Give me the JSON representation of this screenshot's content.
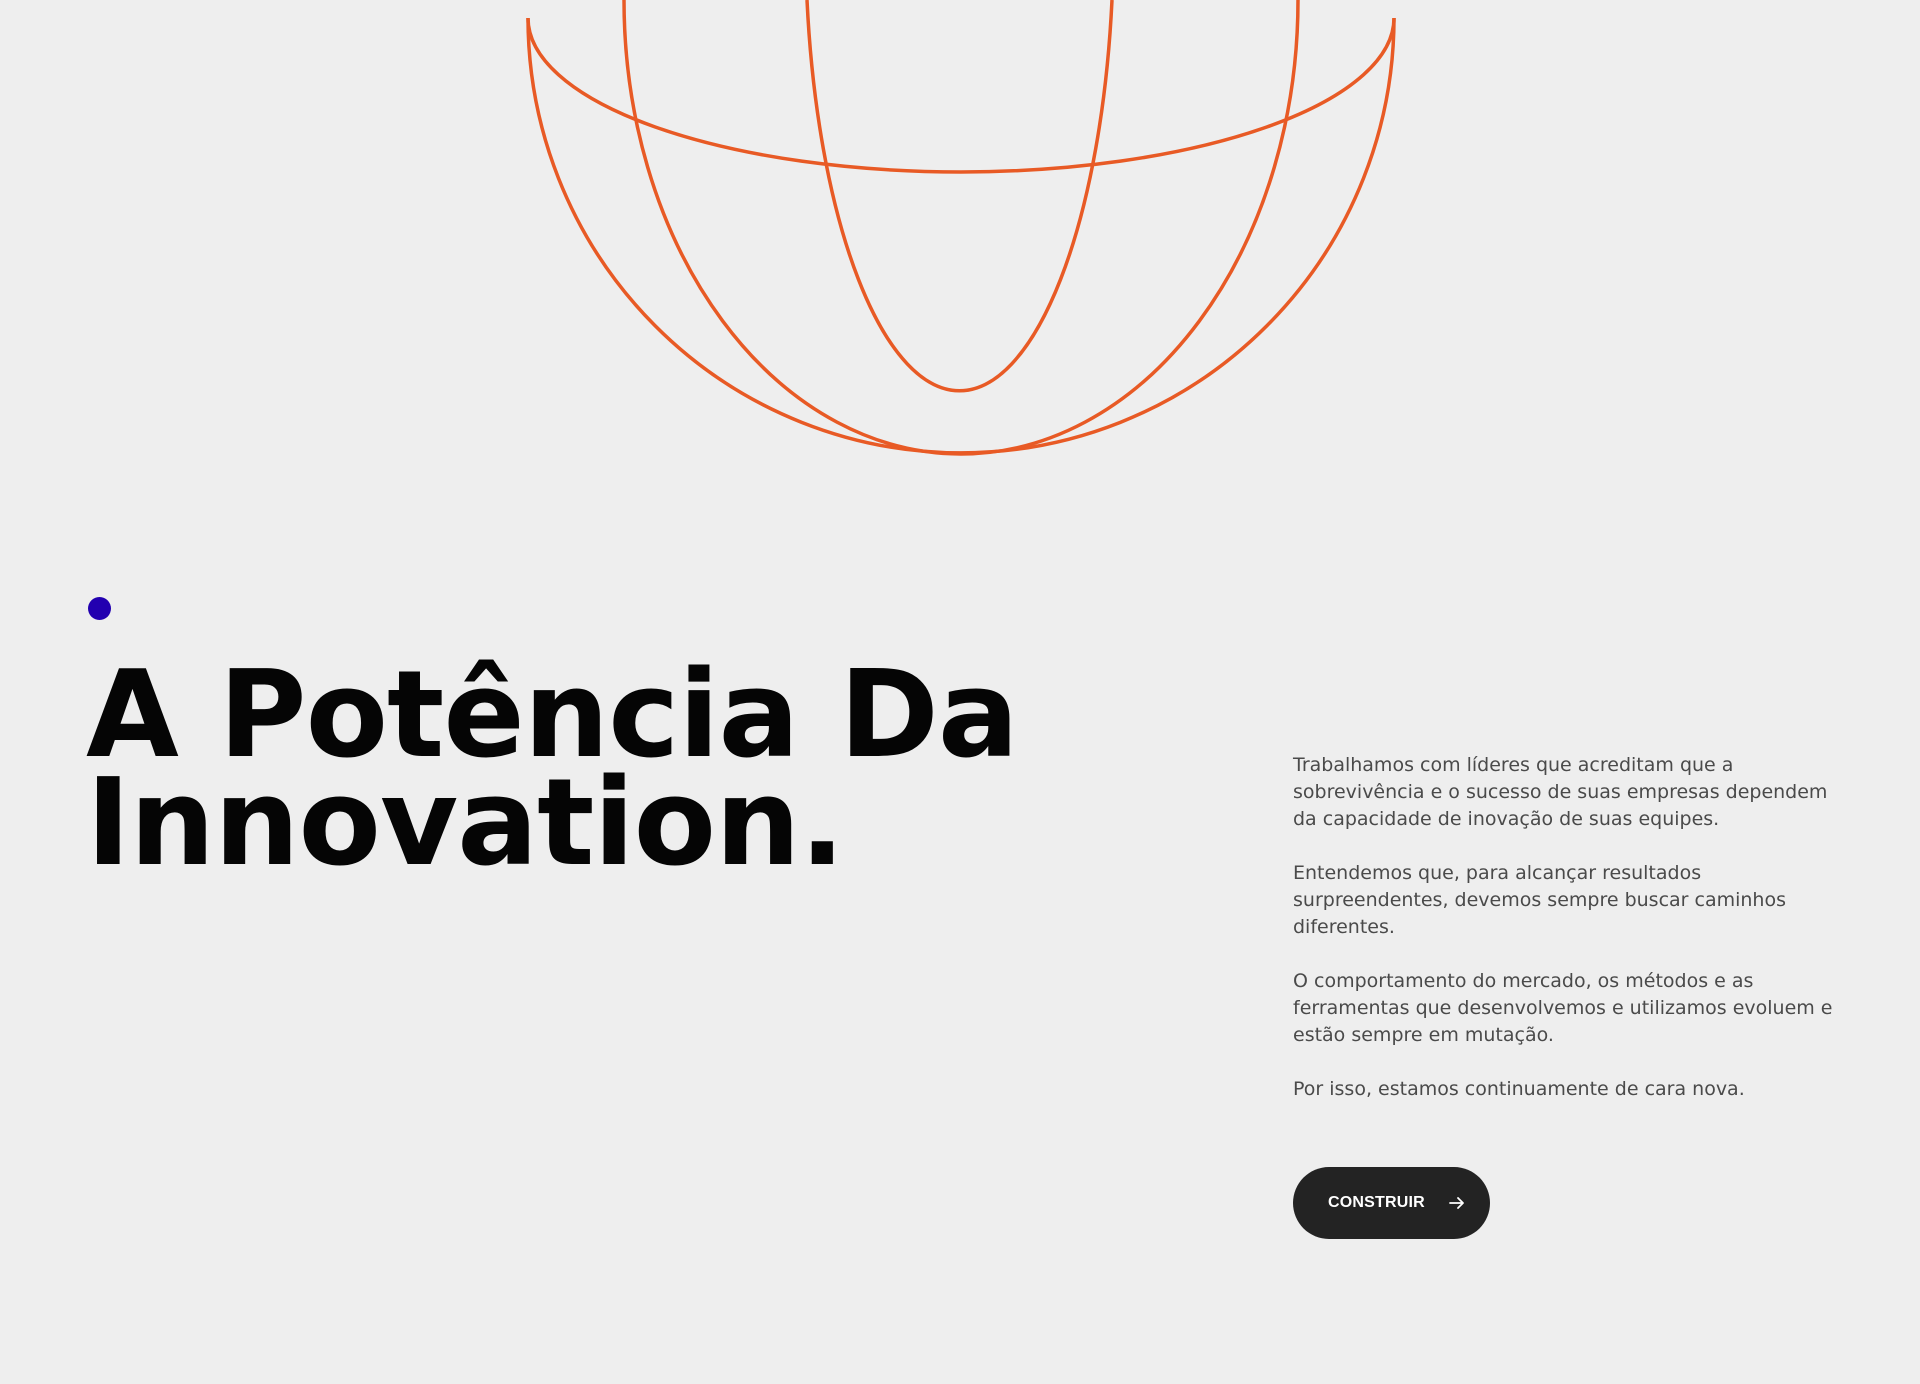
{
  "hero": {
    "headline_line1": "A Potência Da",
    "headline_line2": "Innovation.",
    "accent_dot_color": "#2200b0"
  },
  "globe": {
    "stroke_color": "#e85a25",
    "icon": "globe-wireframe-icon"
  },
  "intro": {
    "paragraphs": [
      "Trabalhamos com líderes que acreditam que a sobrevivência e o sucesso de suas empresas dependem da capacidade de inovação de suas equipes.",
      "Entendemos que, para alcançar resultados surpreendentes, devemos sempre buscar caminhos diferentes.",
      "O comportamento do mercado, os métodos e as ferramentas que desenvolvemos e utilizamos evoluem e estão sempre em mutação.",
      "Por isso, estamos continuamente de cara nova."
    ]
  },
  "cta": {
    "label": "CONSTRUIR",
    "icon": "arrow-right-icon"
  }
}
